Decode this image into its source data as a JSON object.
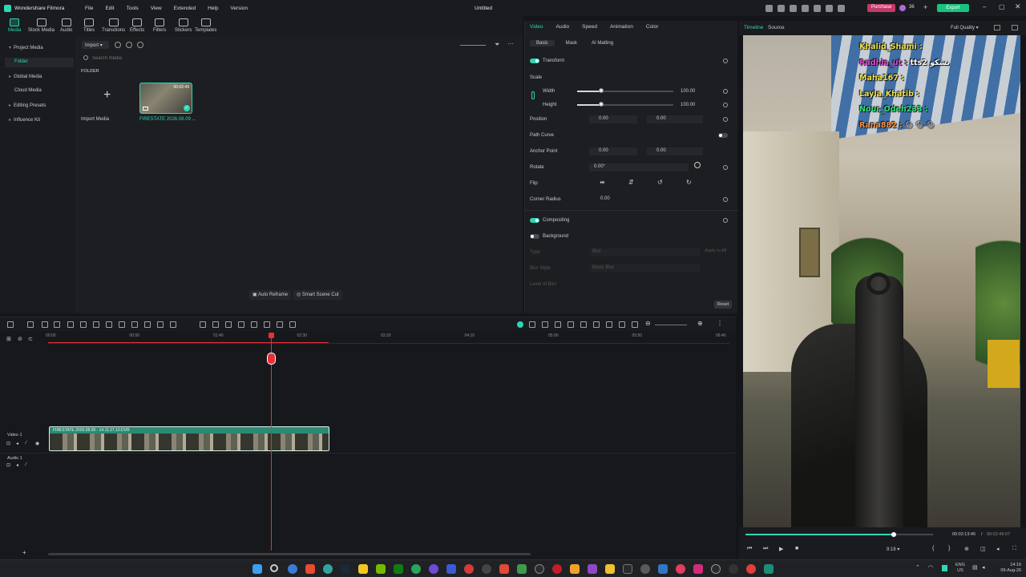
{
  "app": {
    "name": "Wondershare Filmora",
    "title": "Untitled",
    "menu": [
      "File",
      "Edit",
      "Tools",
      "View",
      "Extended",
      "Help",
      "Version"
    ],
    "purchase_label": "Purchase",
    "export_label": "Export",
    "points": "36"
  },
  "toolbar": {
    "tabs": [
      {
        "label": "Media",
        "icon": "media-icon"
      },
      {
        "label": "Stock Media",
        "icon": "stock-media-icon"
      },
      {
        "label": "Audio",
        "icon": "audio-icon"
      },
      {
        "label": "Titles",
        "icon": "titles-icon"
      },
      {
        "label": "Transitions",
        "icon": "transitions-icon"
      },
      {
        "label": "Effects",
        "icon": "effects-icon"
      },
      {
        "label": "Filters",
        "icon": "filters-icon"
      },
      {
        "label": "Stickers",
        "icon": "stickers-icon"
      },
      {
        "label": "Templates",
        "icon": "templates-icon"
      }
    ]
  },
  "sidebar": {
    "items": [
      {
        "label": "Project Media",
        "expanded": true
      },
      {
        "label": "Folder",
        "selected": true
      },
      {
        "label": "Global Media"
      },
      {
        "label": "Cloud Media"
      },
      {
        "label": "Editing Presets"
      },
      {
        "label": "Influence Kit"
      }
    ]
  },
  "media": {
    "import_button": "Import",
    "search_placeholder": "Search media",
    "folder_label": "FOLDER",
    "import_tile_label": "Import Media",
    "clip": {
      "name": "FIRESTATE 2026.08.09 ...",
      "duration": "00:02:49"
    },
    "auto_reframe": "Auto Reframe",
    "smart_scene_cut": "Smart Scene Cut"
  },
  "properties": {
    "tabs": [
      "Video",
      "Audio",
      "Speed",
      "Animation",
      "Color"
    ],
    "subtabs": [
      "Basic",
      "Mask",
      "AI Matting"
    ],
    "transform_label": "Transform",
    "scale_label": "Scale",
    "width_label": "Width",
    "width_value": "100.00",
    "height_label": "Height",
    "height_value": "100.00",
    "scale_fraction": 0.25,
    "position_label": "Position",
    "position_x": "0.00",
    "position_y": "0.00",
    "path_curve_label": "Path Curve",
    "anchor_label": "Anchor Point",
    "anchor_x": "0.00",
    "anchor_y": "0.00",
    "rotate_label": "Rotate",
    "rotate_value": "0.00°",
    "flip_label": "Flip",
    "corner_label": "Corner Radius",
    "corner_value": "0.00",
    "compositing_label": "Compositing",
    "background_label": "Background",
    "type_label": "Type",
    "type_value": "Blur",
    "apply_all": "Apply to All",
    "blur_style_label": "Blur Style",
    "blur_style_value": "Basic Blur",
    "level_label": "Level of Blur",
    "reset_label": "Reset"
  },
  "preview": {
    "tabs": [
      "Timeline",
      "Source"
    ],
    "quality": "Full Quality",
    "current_time": "00:02:13:46",
    "total_time": "00:02:49:07",
    "progress": 0.79,
    "aspect": "9:16",
    "chat": [
      {
        "user": "Khalid_Shami :",
        "msg": "",
        "color": "#f0e14a"
      },
      {
        "user": "Radhia_ut :",
        "msg": "tts2 نشكو",
        "color": "#e04ad8"
      },
      {
        "user": "Maha167 :",
        "msg": "",
        "color": "#f0e14a"
      },
      {
        "user": "Layla_Khatib :",
        "msg": "",
        "color": "#f0e14a"
      },
      {
        "user": "Nour_Odeh233 :",
        "msg": "",
        "color": "#36e07c"
      },
      {
        "user": "Rana882 :",
        "msg": "😁 😁 😁",
        "color": "#f0904a"
      }
    ]
  },
  "timeline": {
    "ruler": [
      "00:00",
      "00:50",
      "01:40",
      "02:30",
      "03:20",
      "04:10",
      "05:00",
      "05:50",
      "06:40"
    ],
    "video_track": "Video 1",
    "audio_track": "Audio 1",
    "clip_name": "FIRESTATE 2026.08.09 - 14.11.27.10.DVR",
    "playhead_time_fraction": 0.79
  },
  "taskbar": {
    "lang": "ENG",
    "region": "US",
    "time": "14:16",
    "date": "09-Aug-26"
  },
  "colors": {
    "accent": "#2fd6b5",
    "playhead": "#e8303a",
    "export": "#19c37d",
    "purchase": "#c4396b"
  }
}
